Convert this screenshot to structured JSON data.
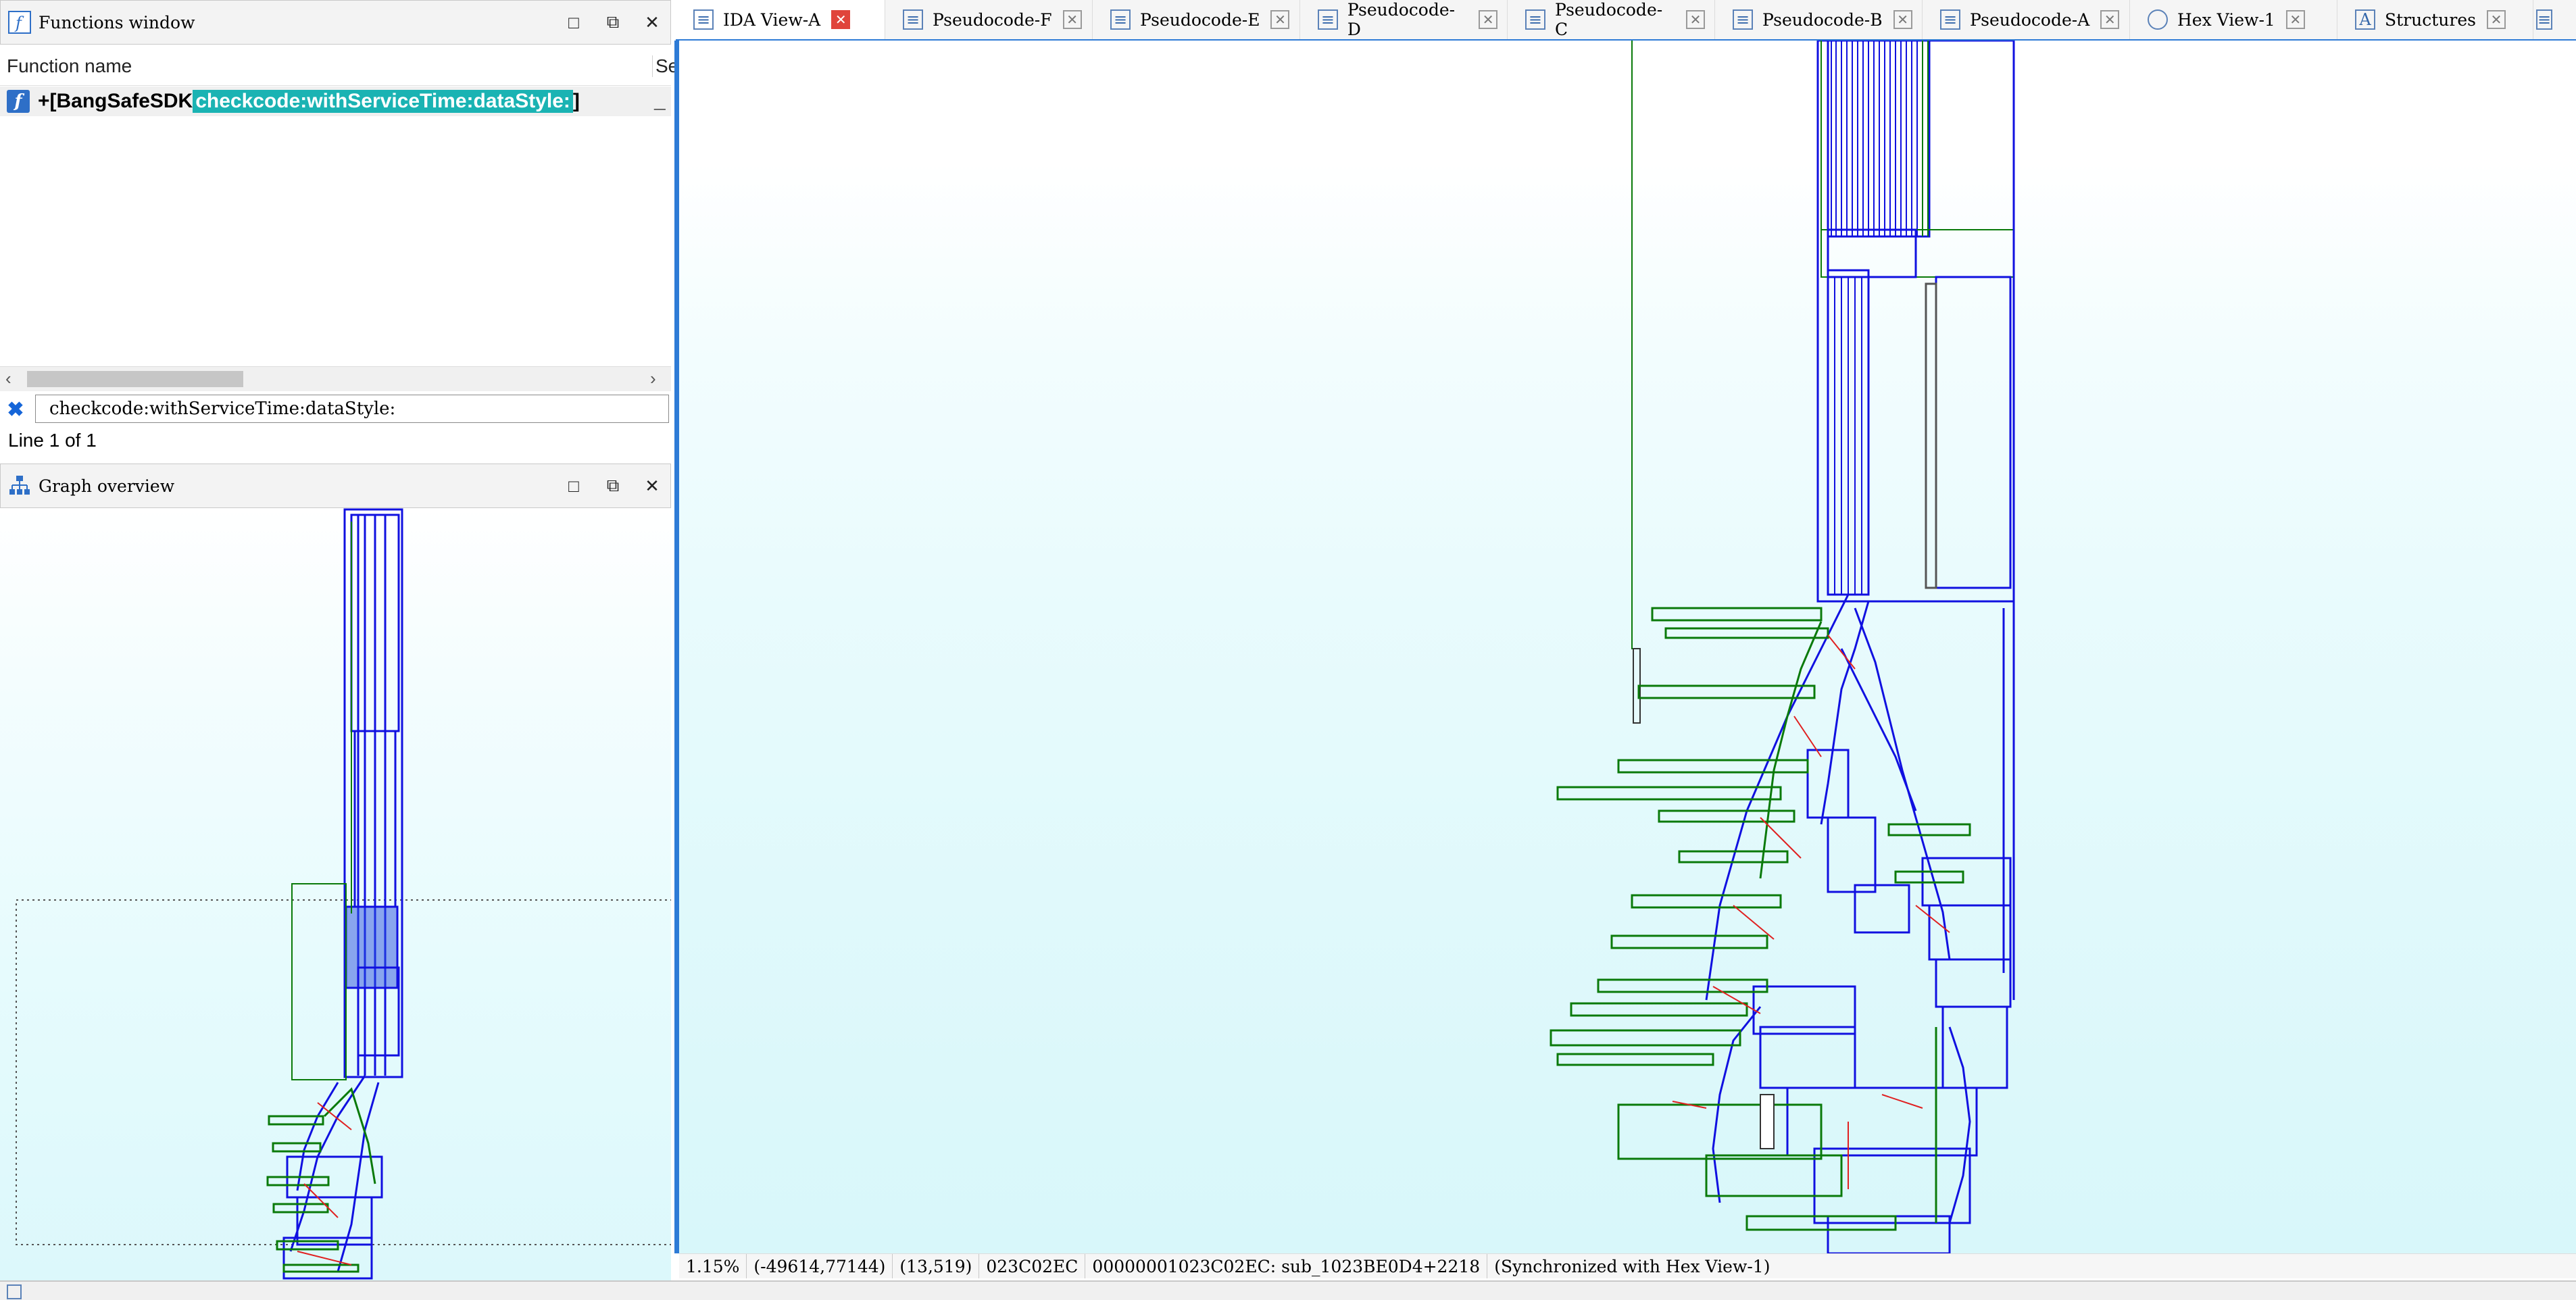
{
  "functions_window": {
    "title": "Functions window",
    "col_function_name": "Function name",
    "col_segment": "Se",
    "row": {
      "prefix": "+[BangSafeSDK ",
      "highlight": "checkcode:withServiceTime:dataStyle:",
      "suffix": "]",
      "segment": "_"
    },
    "filter_value": "checkcode:withServiceTime:dataStyle:",
    "line_status": "Line 1 of 1"
  },
  "graph_overview": {
    "title": "Graph overview"
  },
  "tabs": [
    {
      "label": "IDA View-A",
      "icon": "disasm-icon",
      "active": true
    },
    {
      "label": "Pseudocode-F",
      "icon": "pseudocode-icon",
      "active": false
    },
    {
      "label": "Pseudocode-E",
      "icon": "pseudocode-icon",
      "active": false
    },
    {
      "label": "Pseudocode-D",
      "icon": "pseudocode-icon",
      "active": false
    },
    {
      "label": "Pseudocode-C",
      "icon": "pseudocode-icon",
      "active": false
    },
    {
      "label": "Pseudocode-B",
      "icon": "pseudocode-icon",
      "active": false
    },
    {
      "label": "Pseudocode-A",
      "icon": "pseudocode-icon",
      "active": false
    },
    {
      "label": "Hex View-1",
      "icon": "hex-icon",
      "active": false
    },
    {
      "label": "Structures",
      "icon": "struct-icon",
      "active": false
    }
  ],
  "status_bar": {
    "zoom": "1.15%",
    "coords": "(-49614,77144)",
    "pos": "(13,519)",
    "offset": "023C02EC",
    "address": "00000001023C02EC: sub_1023BE0D4+2218",
    "sync": "(Synchronized with Hex View-1)"
  },
  "colors": {
    "accent": "#2e7bd6",
    "highlight": "#1ab3b3",
    "edge_blue": "#1010e0",
    "edge_green": "#0a7a0a",
    "edge_red": "#e02020",
    "close_active": "#e0443b"
  }
}
